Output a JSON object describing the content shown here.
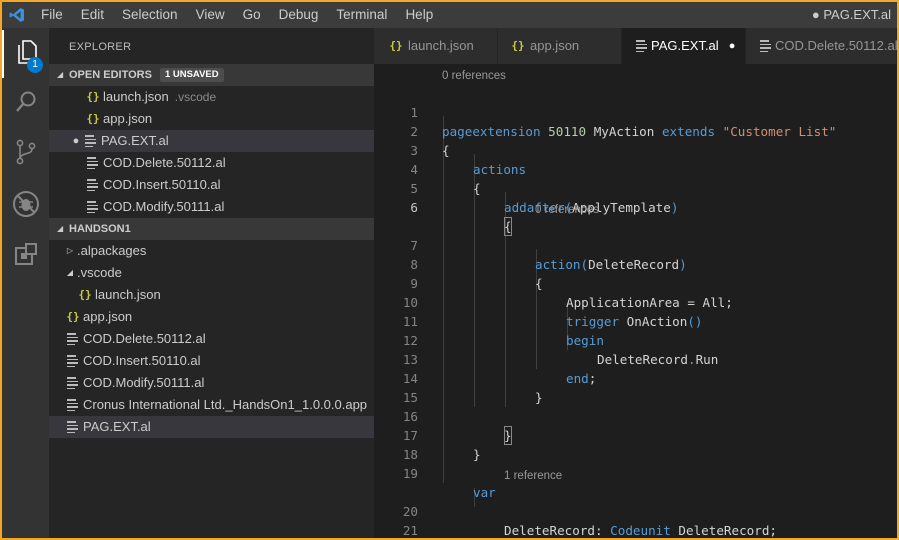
{
  "titlebar": {
    "menu": [
      "File",
      "Edit",
      "Selection",
      "View",
      "Go",
      "Debug",
      "Terminal",
      "Help"
    ],
    "window_title": "● PAG.EXT.al"
  },
  "activity": {
    "badge": "1"
  },
  "sidebar": {
    "title": "EXPLORER",
    "open_editors": {
      "header": "OPEN EDITORS",
      "badge": "1 UNSAVED",
      "items": [
        {
          "label": "launch.json",
          "dir": ".vscode",
          "icon": "json-icon"
        },
        {
          "label": "app.json",
          "icon": "json-icon"
        },
        {
          "label": "PAG.EXT.al",
          "icon": "file-icon",
          "unsaved": "●"
        },
        {
          "label": "COD.Delete.50112.al",
          "icon": "file-icon"
        },
        {
          "label": "COD.Insert.50110.al",
          "icon": "file-icon"
        },
        {
          "label": "COD.Modify.50111.al",
          "icon": "file-icon"
        }
      ]
    },
    "folder": {
      "header": "HANDSON1",
      "items": [
        {
          "label": ".alpackages",
          "chevron": "▷"
        },
        {
          "label": ".vscode",
          "chevron": "◢"
        },
        {
          "label": "launch.json"
        },
        {
          "label": "app.json"
        },
        {
          "label": "COD.Delete.50112.al"
        },
        {
          "label": "COD.Insert.50110.al"
        },
        {
          "label": "COD.Modify.50111.al"
        },
        {
          "label": "Cronus International Ltd._HandsOn1_1.0.0.0.app"
        },
        {
          "label": "PAG.EXT.al"
        }
      ]
    }
  },
  "tabs": [
    {
      "label": "launch.json"
    },
    {
      "label": "app.json"
    },
    {
      "label": "PAG.EXT.al",
      "dirty": "●"
    },
    {
      "label": "COD.Delete.50112.al"
    }
  ],
  "editor": {
    "lens": [
      "0 references",
      "0 references",
      "1 reference"
    ],
    "line_numbers": [
      "1",
      "2",
      "3",
      "4",
      "5",
      "6",
      "7",
      "8",
      "9",
      "10",
      "11",
      "12",
      "13",
      "14",
      "15",
      "16",
      "17",
      "18",
      "19",
      "20",
      "21"
    ],
    "code": {
      "l1": {
        "kw1": "pageextension",
        "num": "50110",
        "name": "MyAction",
        "kw2": "extends",
        "str": "\"Customer List\""
      },
      "l2": "{",
      "l3": "actions",
      "l4": "{",
      "l5": {
        "fn": "addafter",
        "open": "(",
        "arg": "ApplyTemplate",
        "close": ")"
      },
      "l6": "{",
      "l7": {
        "fn": "action",
        "open": "(",
        "arg": "DeleteRecord",
        "close": ")"
      },
      "l8": "{",
      "l9": {
        "prop": "ApplicationArea",
        "eq": " = ",
        "val": "All",
        "semi": ";"
      },
      "l10": {
        "kw": "trigger",
        "fn": "OnAction",
        "parens": "()"
      },
      "l11": "begin",
      "l12": {
        "var": "DeleteRecord",
        "dot": ".",
        "fn": "Run"
      },
      "l13": {
        "kw": "end",
        "semi": ";"
      },
      "l14": "}",
      "l16": "}",
      "l17": "}",
      "l19": "var",
      "l20": {
        "var": "DeleteRecord",
        "colon": ": ",
        "ty": "Codeunit",
        "name": " DeleteRecord",
        "semi": ";"
      },
      "l21": "}"
    }
  }
}
